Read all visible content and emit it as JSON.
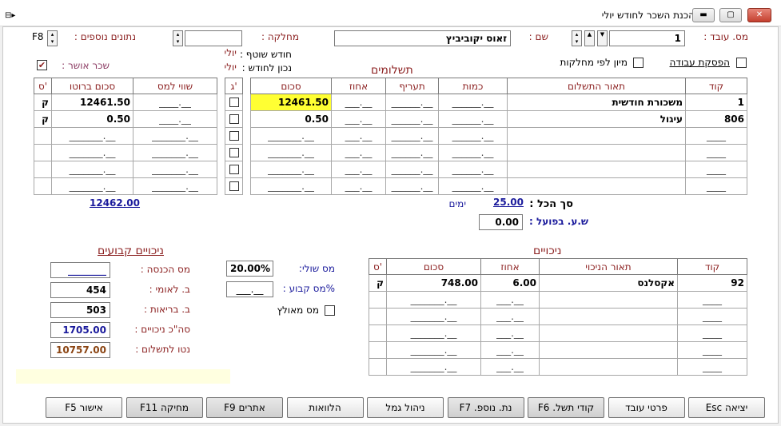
{
  "window": {
    "title": "הכנת השכר לחודש יולי"
  },
  "header": {
    "employee_no_label": "מס. עובד :",
    "employee_no_value": "1",
    "name_label": "שם :",
    "name_value": "זאוס יקוביביץ",
    "department_label": "מחלקה :",
    "department_value": "",
    "extra_data_label": "נתונים נוספים :",
    "extra_data_key": "F8",
    "current_month_label": "חודש שוטף :",
    "current_month_value": "יולי",
    "for_month_label": "נכון לחודש :",
    "for_month_value": "יולי",
    "stop_work_label": "הפסקת עבודה",
    "sort_by_dept_label": "מיון לפי מחלקות",
    "approved_wage_label": "שכר אושר :",
    "approved_wage_check": "✔"
  },
  "payments": {
    "title": "תשלומים",
    "columns": [
      "קוד",
      "תאור התשלום",
      "כמות",
      "תעריף",
      "אחוז",
      "סכום"
    ],
    "rows": [
      {
        "code": "1",
        "desc": "משכורת חודשית",
        "qty": "______.__",
        "rate": "______.__",
        "pct": "___.__",
        "amount": "12461.50"
      },
      {
        "code": "806",
        "desc": "עיגול",
        "qty": "______.__",
        "rate": "______.__",
        "pct": "___.__",
        "amount": "0.50"
      },
      {
        "code": "____",
        "desc": "",
        "qty": "______.__",
        "rate": "______.__",
        "pct": "___.__",
        "amount": "_______.__"
      },
      {
        "code": "____",
        "desc": "",
        "qty": "______.__",
        "rate": "______.__",
        "pct": "___.__",
        "amount": "_______.__"
      },
      {
        "code": "____",
        "desc": "",
        "qty": "______.__",
        "rate": "______.__",
        "pct": "___.__",
        "amount": "_______.__"
      },
      {
        "code": "____",
        "desc": "",
        "qty": "______.__",
        "rate": "______.__",
        "pct": "___.__",
        "amount": "_______.__"
      }
    ],
    "g_col_label": "ג'",
    "total_label": "סך הכל :",
    "total_days": "25.00",
    "days_label": "ימים",
    "actual_hours_label": "ש.ע. בפועל :",
    "actual_hours_value": "0.00"
  },
  "gross": {
    "columns": [
      "שווי למס",
      "סכום ברוטו",
      "ס'"
    ],
    "rows": [
      {
        "tax_value": "____.__",
        "gross": "12461.50",
        "s": "ק"
      },
      {
        "tax_value": "____.__",
        "gross": "0.50",
        "s": "ק"
      },
      {
        "tax_value": "_______.__",
        "gross": "_______.__",
        "s": ""
      },
      {
        "tax_value": "_______.__",
        "gross": "_______.__",
        "s": ""
      },
      {
        "tax_value": "_______.__",
        "gross": "_______.__",
        "s": ""
      },
      {
        "tax_value": "_______.__",
        "gross": "_______.__",
        "s": ""
      }
    ],
    "total": "12462.00"
  },
  "deductions": {
    "title": "ניכויים",
    "columns": [
      "קוד",
      "תאור הניכוי",
      "אחוז",
      "סכום",
      "ס'"
    ],
    "rows": [
      {
        "code": "92",
        "desc": "אקסלנס",
        "pct": "6.00",
        "amount": "748.00",
        "s": "ק"
      },
      {
        "code": "____",
        "desc": "",
        "pct": "___.__",
        "amount": "_______.__",
        "s": ""
      },
      {
        "code": "____",
        "desc": "",
        "pct": "___.__",
        "amount": "_______.__",
        "s": ""
      },
      {
        "code": "____",
        "desc": "",
        "pct": "___.__",
        "amount": "_______.__",
        "s": ""
      },
      {
        "code": "____",
        "desc": "",
        "pct": "___.__",
        "amount": "_______.__",
        "s": ""
      },
      {
        "code": "____",
        "desc": "",
        "pct": "___.__",
        "amount": "_______.__",
        "s": ""
      }
    ]
  },
  "tax": {
    "marginal_label": "מס שולי:",
    "marginal_value": "20.00%",
    "fixed_label": "%מס קבוע :",
    "fixed_value": "___.__",
    "forced_label": "מס מאולץ"
  },
  "fixed_deductions": {
    "title": "ניכויים קבועים",
    "items": [
      {
        "label": "מס הכנסה :",
        "value": "________",
        "color": "#1a1a9c"
      },
      {
        "label": "ב. לאומי :",
        "value": "454",
        "color": "#000000"
      },
      {
        "label": "ב. בריאות :",
        "value": "503",
        "color": "#000000"
      },
      {
        "label": "סה\"כ ניכויים :",
        "value": "1705.00",
        "color": "#1a1a9c"
      },
      {
        "label": "נטו לתשלום :",
        "value": "10757.00",
        "color": "#8b4513"
      }
    ]
  },
  "buttons": [
    {
      "label": "יציאה Esc",
      "name": "exit-button"
    },
    {
      "label": "פרטי עובד",
      "name": "employee-details-button"
    },
    {
      "label": "קודי תשל. F6",
      "name": "payment-codes-button"
    },
    {
      "label": "נת. נוספ. F7",
      "name": "extra-data-button"
    },
    {
      "label": "ניהול גמל",
      "name": "pension-management-button"
    },
    {
      "label": "הלוואות",
      "name": "loans-button"
    },
    {
      "label": "אתרים F9",
      "name": "sites-button"
    },
    {
      "label": "מחיקה F11",
      "name": "delete-button"
    },
    {
      "label": "אישור F5",
      "name": "approve-button"
    }
  ]
}
